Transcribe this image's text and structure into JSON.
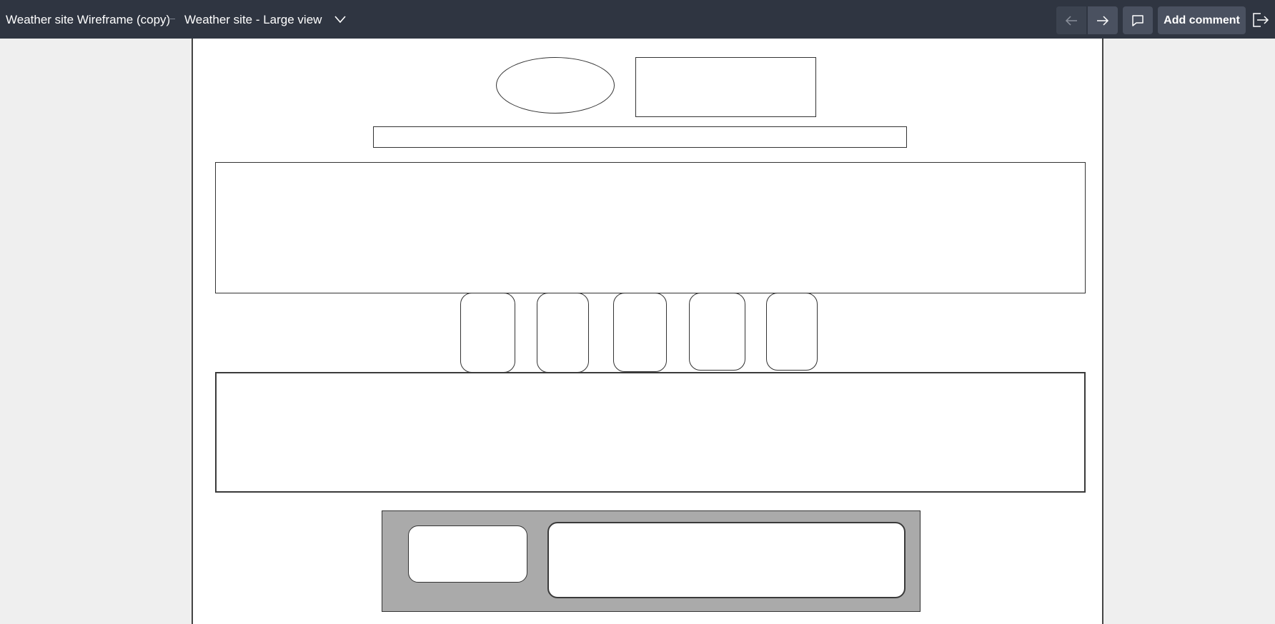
{
  "header": {
    "project_title": "Weather site Wireframe (copy)",
    "page_title": "Weather site - Large view",
    "add_comment_label": "Add comment",
    "icons": {
      "dropdown": "chevron-down-icon",
      "previous": "arrow-left-icon",
      "next": "arrow-right-icon",
      "comments": "speech-bubble-icon",
      "exit": "exit-icon"
    }
  },
  "colors": {
    "toolbar_background": "#2f3541",
    "button_background": "#4a5160",
    "canvas_background": "#ffffff",
    "workspace_background": "#efefef",
    "footer_panel_fill": "#aaaaaa"
  }
}
